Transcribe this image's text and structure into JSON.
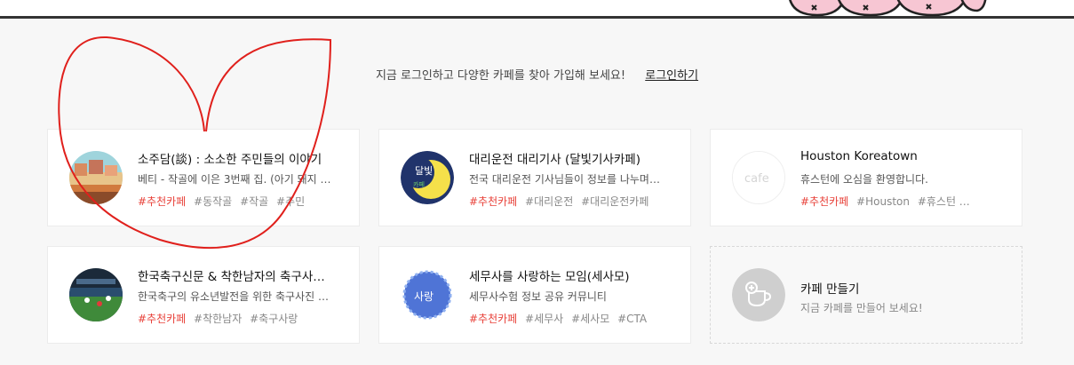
{
  "login": {
    "message": "지금 로그인하고 다양한 카페를 찾아 가입해 보세요!",
    "link_label": "로그인하기"
  },
  "colors": {
    "recommend_tag": "#e8423a",
    "annotation_stroke": "#e0201c"
  },
  "cafes": [
    {
      "title": "소주담(談) : 소소한 주민들의 이야기",
      "desc": "베티 - 작골에 이은 3번째 집. (아기 돼지 …",
      "rec_tag": "#추천카페",
      "tags": [
        "#동작골",
        "#작골",
        "#주민"
      ],
      "avatar": "landscape-painting"
    },
    {
      "title": "대리운전 대리기사 (달빛기사카페)",
      "desc": "전국 대리운전 기사님들이 정보를 나누며…",
      "rec_tag": "#추천카페",
      "tags": [
        "#대리운전",
        "#대리운전카페"
      ],
      "avatar": "moon-logo",
      "avatar_text_top": "달빛",
      "avatar_text_bottom": "카페"
    },
    {
      "title": "Houston Koreatown",
      "desc": "휴스턴에 오심을 환영합니다.",
      "rec_tag": "#추천카페",
      "tags": [
        "#Houston",
        "#휴스턴 …"
      ],
      "avatar": "cafe-placeholder",
      "avatar_text": "cafe"
    },
    {
      "title": "한국축구신문 & 착한남자의 축구사…",
      "desc": "한국축구의 유소년발전을 위한 축구사진 …",
      "rec_tag": "#추천카페",
      "tags": [
        "#착한남자",
        "#축구사랑"
      ],
      "avatar": "soccer-photo"
    },
    {
      "title": "세무사를 사랑하는 모임(세사모)",
      "desc": "세무사수험 정보 공유 커뮤니티",
      "rec_tag": "#추천카페",
      "tags": [
        "#세무사",
        "#세사모",
        "#CTA"
      ],
      "avatar": "blue-badge",
      "avatar_text": "사랑"
    }
  ],
  "create": {
    "title": "카페 만들기",
    "desc": "지금 카페를 만들어 보세요!",
    "icon": "add-cup-icon"
  }
}
